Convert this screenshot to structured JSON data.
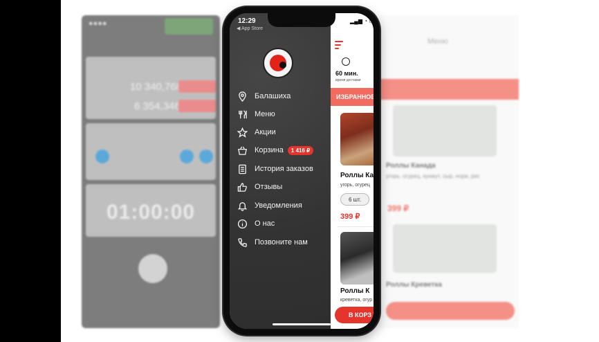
{
  "status": {
    "time": "12:29",
    "back_label": "◀ App Store"
  },
  "menu": {
    "items": [
      {
        "label": "Балашиха",
        "icon": "location-pin-icon"
      },
      {
        "label": "Меню",
        "icon": "cutlery-icon"
      },
      {
        "label": "Акции",
        "icon": "star-icon"
      },
      {
        "label": "Корзина",
        "icon": "basket-icon",
        "badge": "1 416 ₽"
      },
      {
        "label": "История заказов",
        "icon": "document-icon"
      },
      {
        "label": "Отзывы",
        "icon": "thumbs-up-icon"
      },
      {
        "label": "Уведомления",
        "icon": "bell-icon"
      },
      {
        "label": "О нас",
        "icon": "info-icon"
      },
      {
        "label": "Позвоните нам",
        "icon": "phone-icon"
      }
    ]
  },
  "content": {
    "delivery_time": "60 мин.",
    "delivery_label": "время доставки",
    "favorites_label": "ИЗБРАННОЕ",
    "products": [
      {
        "name": "Роллы Ка",
        "desc": "угорь, огурец",
        "qty": "6 шт.",
        "price": "399 ₽"
      },
      {
        "name": "Роллы К",
        "desc": "креветка, огур"
      }
    ],
    "add_button": "В КОРЗ"
  },
  "background_left": {
    "amount1": "10 340,768",
    "amount2": "6 354,346",
    "timer": "01:00:00"
  },
  "background_right": {
    "title": "Меню",
    "product1": "Роллы Канада",
    "product1_desc": "угорь, огурец, кунжут, сыр, нори, рис",
    "product1_price": "399 ₽",
    "product2": "Роллы Креветка"
  },
  "colors": {
    "accent": "#e3352c",
    "menu_bg": "#3b3b3b",
    "favorites_bar": "#f26b60"
  }
}
